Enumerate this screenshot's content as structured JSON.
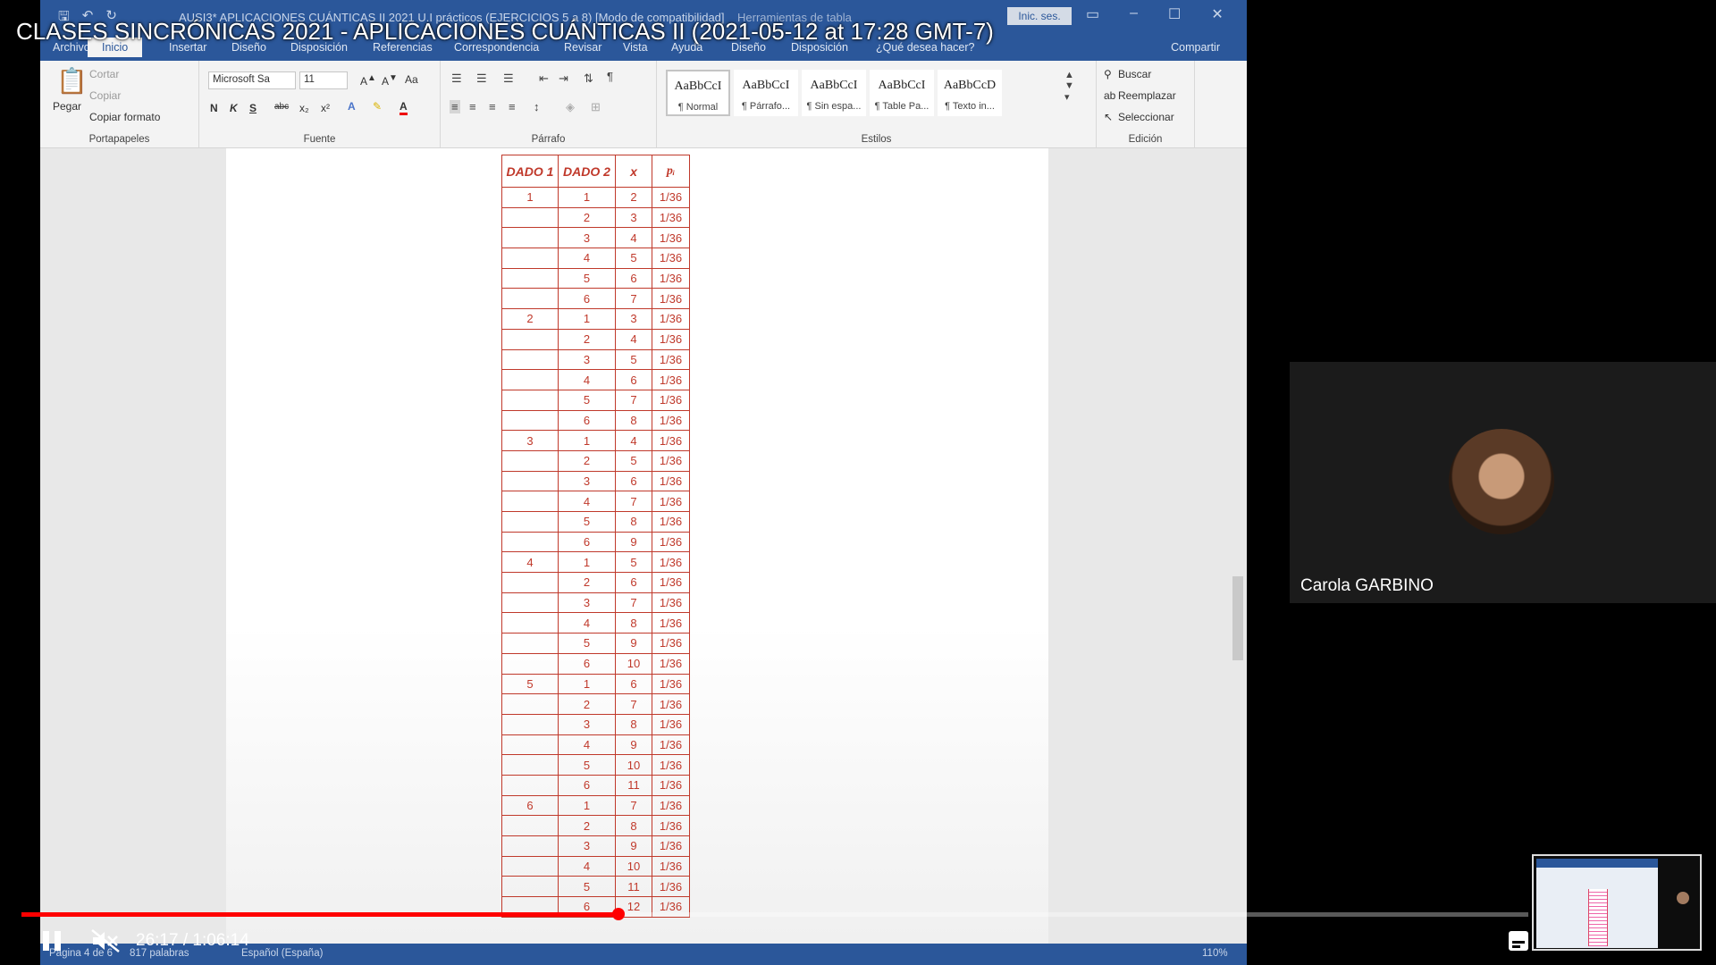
{
  "video": {
    "title": "CLASES SINCRÓNICAS 2021 - APLICACIONES CUÁNTICAS II (2021-05-12 at 17:28 GMT-7)",
    "time": "26:17 / 1:06:14",
    "progress_fraction": 0.396
  },
  "word": {
    "doc_title": "AUSI3* APLICACIONES CUÁNTICAS II 2021 U.I prácticos (EJERCICIOS 5 a 8) [Modo de compatibilidad]",
    "tools_title": "Herramientas de tabla",
    "signin": "Inic. ses.",
    "tabs": [
      "Archivo",
      "Inicio",
      "Insertar",
      "Diseño",
      "Disposición",
      "Referencias",
      "Correspondencia",
      "Revisar",
      "Vista",
      "Ayuda",
      "Diseño",
      "Disposición",
      "¿Qué desea hacer?"
    ],
    "share": "Compartir",
    "clipboard": {
      "label": "Portapapeles",
      "paste": "Pegar",
      "cut": "Cortar",
      "copy": "Copiar",
      "format_painter": "Copiar formato"
    },
    "font": {
      "label": "Fuente",
      "name": "Microsoft Sa",
      "size": "11",
      "case": "Aa",
      "bold": "N",
      "italic": "K",
      "underline": "S",
      "strike": "abc",
      "sub": "x₂",
      "sup": "x²"
    },
    "paragraph": {
      "label": "Párrafo"
    },
    "styles": {
      "label": "Estilos",
      "items": [
        {
          "sample": "AaBbCcI",
          "name": "¶ Normal"
        },
        {
          "sample": "AaBbCcI",
          "name": "¶ Párrafo..."
        },
        {
          "sample": "AaBbCcI",
          "name": "¶ Sin espa..."
        },
        {
          "sample": "AaBbCcI",
          "name": "¶ Table Pa..."
        },
        {
          "sample": "AaBbCcD",
          "name": "¶ Texto in..."
        }
      ]
    },
    "editing": {
      "label": "Edición",
      "find": "Buscar",
      "replace": "Reemplazar",
      "select": "Seleccionar"
    },
    "status": {
      "page": "Página 4 de 6",
      "words": "817 palabras",
      "language": "Español (España)",
      "zoom": "110%"
    }
  },
  "table": {
    "headers": [
      "DADO 1",
      "DADO 2",
      "x",
      "pᵢ"
    ],
    "rows": [
      [
        "1",
        "1",
        "2",
        "1/36"
      ],
      [
        "",
        "2",
        "3",
        "1/36"
      ],
      [
        "",
        "3",
        "4",
        "1/36"
      ],
      [
        "",
        "4",
        "5",
        "1/36"
      ],
      [
        "",
        "5",
        "6",
        "1/36"
      ],
      [
        "",
        "6",
        "7",
        "1/36"
      ],
      [
        "2",
        "1",
        "3",
        "1/36"
      ],
      [
        "",
        "2",
        "4",
        "1/36"
      ],
      [
        "",
        "3",
        "5",
        "1/36"
      ],
      [
        "",
        "4",
        "6",
        "1/36"
      ],
      [
        "",
        "5",
        "7",
        "1/36"
      ],
      [
        "",
        "6",
        "8",
        "1/36"
      ],
      [
        "3",
        "1",
        "4",
        "1/36"
      ],
      [
        "",
        "2",
        "5",
        "1/36"
      ],
      [
        "",
        "3",
        "6",
        "1/36"
      ],
      [
        "",
        "4",
        "7",
        "1/36"
      ],
      [
        "",
        "5",
        "8",
        "1/36"
      ],
      [
        "",
        "6",
        "9",
        "1/36"
      ],
      [
        "4",
        "1",
        "5",
        "1/36"
      ],
      [
        "",
        "2",
        "6",
        "1/36"
      ],
      [
        "",
        "3",
        "7",
        "1/36"
      ],
      [
        "",
        "4",
        "8",
        "1/36"
      ],
      [
        "",
        "5",
        "9",
        "1/36"
      ],
      [
        "",
        "6",
        "10",
        "1/36"
      ],
      [
        "5",
        "1",
        "6",
        "1/36"
      ],
      [
        "",
        "2",
        "7",
        "1/36"
      ],
      [
        "",
        "3",
        "8",
        "1/36"
      ],
      [
        "",
        "4",
        "9",
        "1/36"
      ],
      [
        "",
        "5",
        "10",
        "1/36"
      ],
      [
        "",
        "6",
        "11",
        "1/36"
      ],
      [
        "6",
        "1",
        "7",
        "1/36"
      ],
      [
        "",
        "2",
        "8",
        "1/36"
      ],
      [
        "",
        "3",
        "9",
        "1/36"
      ],
      [
        "",
        "4",
        "10",
        "1/36"
      ],
      [
        "",
        "5",
        "11",
        "1/36"
      ],
      [
        "",
        "6",
        "12",
        "1/36"
      ]
    ]
  },
  "participant": {
    "name": "Carola GARBINO"
  },
  "colors": {
    "word_blue": "#2b579a",
    "table_red": "#c0392b",
    "progress_red": "#ff0000"
  },
  "icons": {
    "play_pause": "pause-icon",
    "volume": "muted-icon",
    "captions": "captions-icon"
  }
}
